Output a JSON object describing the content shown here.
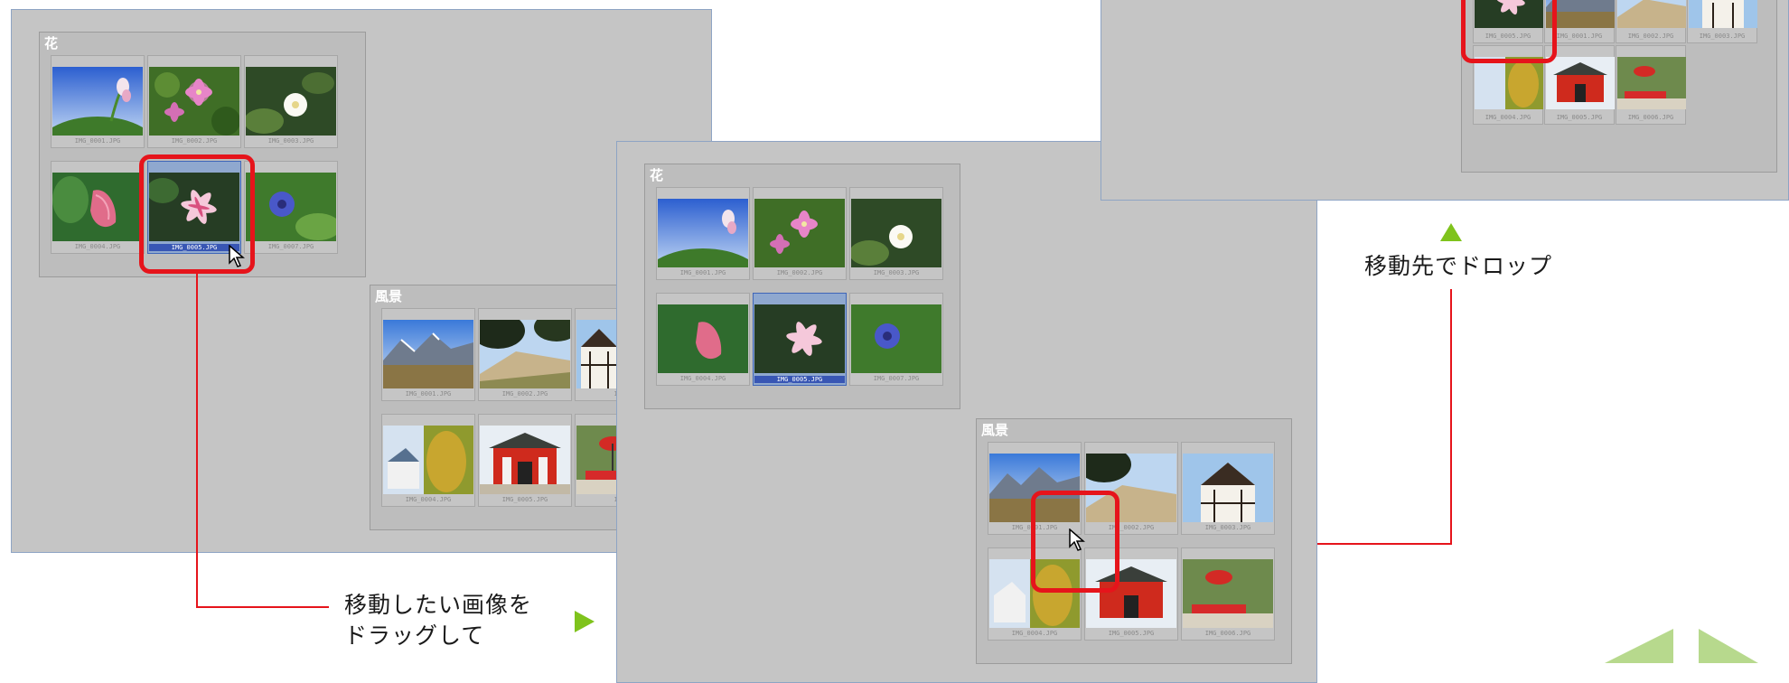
{
  "panels": {
    "before": {
      "flowers_title": "花",
      "landscape_title": "風景",
      "flowers": [
        "IMG_0001.JPG",
        "IMG_0002.JPG",
        "IMG_0003.JPG",
        "IMG_0004.JPG",
        "IMG_0005.JPG",
        "IMG_0007.JPG"
      ],
      "landscape": [
        "IMG_0001.JPG",
        "IMG_0002.JPG",
        "IMG_",
        "IMG_0004.JPG",
        "IMG_0005.JPG",
        "IMG_"
      ]
    },
    "during": {
      "flowers_title": "花",
      "landscape_title": "風景",
      "flowers": [
        "IMG_0001.JPG",
        "IMG_0002.JPG",
        "IMG_0003.JPG",
        "IMG_0004.JPG",
        "IMG_0005.JPG",
        "IMG_0007.JPG"
      ],
      "landscape": [
        "IMG_0001.JPG",
        "IMG_0002.JPG",
        "IMG_0003.JPG",
        "IMG_0004.JPG",
        "IMG_0005.JPG",
        "IMG_0006.JPG"
      ]
    },
    "after": {
      "landscape": [
        "IMG_0005.JPG",
        "IMG_0001.JPG",
        "IMG_0002.JPG",
        "IMG_0003.JPG",
        "IMG_0004.JPG",
        "IMG_0005.JPG",
        "IMG_0006.JPG"
      ]
    }
  },
  "labels": {
    "drag_line1": "移動したい画像を",
    "drag_line2": "ドラッグして",
    "drop": "移動先でドロップ"
  },
  "colors": {
    "highlight": "#e6141b",
    "arrow": "#7fc31c",
    "selection": "#3856b4"
  }
}
